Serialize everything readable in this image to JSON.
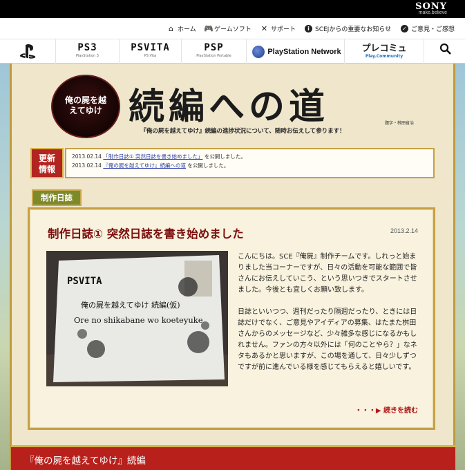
{
  "brand": {
    "logo": "SONY",
    "tagline": "make.believe"
  },
  "util_nav": {
    "items": [
      {
        "label": "ホーム",
        "icon": "home-icon"
      },
      {
        "label": "ゲームソフト",
        "icon": "gamepad-icon"
      },
      {
        "label": "サポート",
        "icon": "tools-icon"
      },
      {
        "label": "SCEJからの重要なお知らせ",
        "icon": "info-icon"
      },
      {
        "label": "ご意見・ご感想",
        "icon": "check-icon"
      }
    ]
  },
  "platform_nav": {
    "items": [
      {
        "label": "PS3",
        "sub": "PlayStation 3"
      },
      {
        "label": "PSVITA",
        "sub": "PS Vita"
      },
      {
        "label": "PSP",
        "sub": "PlayStation Portable"
      },
      {
        "label": "PlayStation Network"
      },
      {
        "label": "プレコミュ",
        "sub": "Play.Community"
      }
    ]
  },
  "header": {
    "emblem_text": "俺の屍を越えてゆけ",
    "title": "続編への道",
    "credit": "題字・桝田省治",
    "subtitle": "『俺の屍を越えてゆけ』続編の進捗状況について、随時お伝えして参ります！"
  },
  "updates": {
    "label": "更新情報",
    "items": [
      {
        "date": "2013.02.14",
        "link": "「制作日誌① 突然日誌を書き始めました」",
        "suffix": "を公開しました。"
      },
      {
        "date": "2013.02.14",
        "link": "『俺の屍を越えてゆけ』続編への道",
        "suffix": "を公開しました。"
      }
    ]
  },
  "section": {
    "label": "制作日誌"
  },
  "article": {
    "title": "制作日誌① 突然日誌を書き始めました",
    "date": "2013.2.14",
    "photo_card": {
      "brand": "PSVITA",
      "title": "俺の屍を越えてゆけ 続編(仮)",
      "romaji": "Ore no shikabane wo koeteyuke"
    },
    "paragraphs": [
      "こんにちは。SCE『俺屍』制作チームです。しれっと始まりました当コーナーですが、日々の活動を可能な範囲で皆さんにお伝えしていこう、という思いつきでスタートさせました。今後とも宜しくお願い致します。",
      "日誌といいつつ、週刊だったり隔週だったり、ときには日誌だけでなく、ご意見やアイディアの募集、はたまた桝田さんからのメッセージなど、少々雑多な感じになるかもしれません。ファンの方々以外には「何のことやら？」なネタもあるかと思いますが、この場を通して、日々少しずつですが前に進んでいる様を感じてもらえると嬉しいです。"
    ],
    "read_more": "・・・▶ 続きを読む"
  },
  "bottom": {
    "title": "『俺の屍を越えてゆけ』続編"
  },
  "colors": {
    "accent_red": "#b2241f",
    "gold": "#c6a043",
    "title_red": "#7c0f0f",
    "link_blue": "#2a3ea8"
  }
}
